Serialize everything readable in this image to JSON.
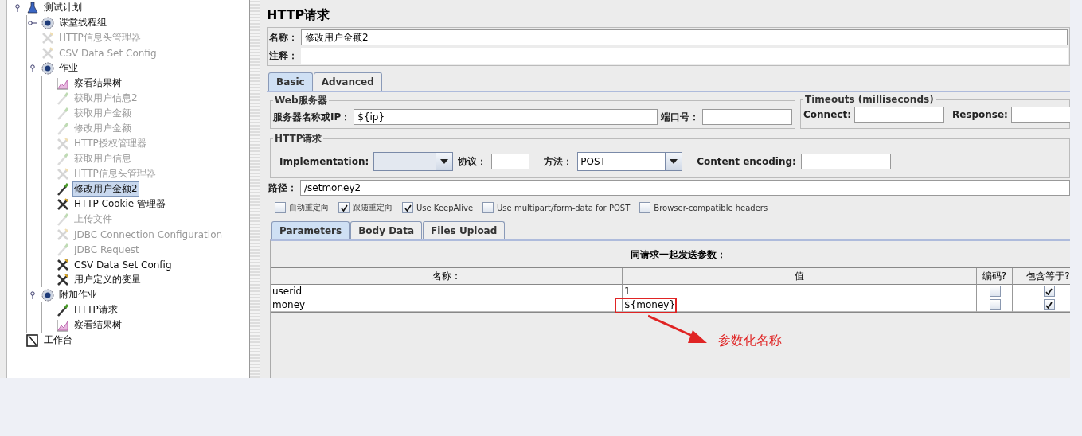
{
  "tree": [
    {
      "label": "测试计划",
      "kind": "plan",
      "disabled": false,
      "selected": false,
      "expanded": true,
      "children": [
        {
          "label": "课堂线程组",
          "kind": "threadgroup",
          "disabled": false,
          "selected": false,
          "expanded": false
        },
        {
          "label": "HTTP信息头管理器",
          "kind": "config",
          "disabled": true,
          "selected": false
        },
        {
          "label": "CSV Data Set Config",
          "kind": "config",
          "disabled": true,
          "selected": false
        },
        {
          "label": "作业",
          "kind": "threadgroup",
          "disabled": false,
          "selected": false,
          "expanded": true,
          "children": [
            {
              "label": "察看结果树",
              "kind": "listener",
              "disabled": false,
              "selected": false
            },
            {
              "label": "获取用户信息2",
              "kind": "sampler",
              "disabled": true,
              "selected": false
            },
            {
              "label": "获取用户金额",
              "kind": "sampler",
              "disabled": true,
              "selected": false
            },
            {
              "label": "修改用户金额",
              "kind": "sampler",
              "disabled": true,
              "selected": false
            },
            {
              "label": "HTTP授权管理器",
              "kind": "config",
              "disabled": true,
              "selected": false
            },
            {
              "label": "获取用户信息",
              "kind": "sampler",
              "disabled": true,
              "selected": false
            },
            {
              "label": "HTTP信息头管理器",
              "kind": "config",
              "disabled": true,
              "selected": false
            },
            {
              "label": "修改用户金额2",
              "kind": "sampler",
              "disabled": false,
              "selected": true
            },
            {
              "label": "HTTP Cookie 管理器",
              "kind": "config",
              "disabled": false,
              "selected": false
            },
            {
              "label": "上传文件",
              "kind": "sampler",
              "disabled": true,
              "selected": false
            },
            {
              "label": "JDBC Connection Configuration",
              "kind": "config",
              "disabled": true,
              "selected": false
            },
            {
              "label": "JDBC Request",
              "kind": "sampler",
              "disabled": true,
              "selected": false
            },
            {
              "label": "CSV Data Set Config",
              "kind": "config",
              "disabled": false,
              "selected": false
            },
            {
              "label": "用户定义的变量",
              "kind": "config",
              "disabled": false,
              "selected": false
            }
          ]
        },
        {
          "label": "附加作业",
          "kind": "threadgroup",
          "disabled": false,
          "selected": false,
          "expanded": true,
          "children": [
            {
              "label": "HTTP请求",
              "kind": "sampler",
              "disabled": false,
              "selected": false
            },
            {
              "label": "察看结果树",
              "kind": "listener",
              "disabled": false,
              "selected": false
            }
          ]
        }
      ]
    },
    {
      "label": "工作台",
      "kind": "workbench",
      "disabled": false,
      "selected": false
    }
  ],
  "editor": {
    "title": "HTTP请求",
    "name_label": "名称：",
    "name_value": "修改用户金额2",
    "comment_label": "注释：",
    "tabs": [
      {
        "label": "Basic",
        "selected": true
      },
      {
        "label": "Advanced",
        "selected": false
      }
    ],
    "web_server": {
      "legend": "Web服务器",
      "server_label": "服务器名称或IP：",
      "server_value": "${ip}",
      "port_label": "端口号："
    },
    "timeouts": {
      "legend": "Timeouts (milliseconds)",
      "connect_label": "Connect:",
      "response_label": "Response:"
    },
    "http_request": {
      "legend": "HTTP请求",
      "implementation_label": "Implementation:",
      "protocol_label": "协议：",
      "method_label": "方法：",
      "method_value": "POST",
      "encoding_label": "Content encoding:",
      "path_label": "路径：",
      "path_value": "/setmoney2",
      "options": [
        {
          "label": "自动重定向",
          "checked": false
        },
        {
          "label": "跟随重定向",
          "checked": true
        },
        {
          "label": "Use KeepAlive",
          "checked": true
        },
        {
          "label": "Use multipart/form-data for POST",
          "checked": false
        },
        {
          "label": "Browser-compatible headers",
          "checked": false
        }
      ]
    },
    "sub_tabs": [
      {
        "label": "Parameters",
        "selected": true
      },
      {
        "label": "Body Data",
        "selected": false
      },
      {
        "label": "Files Upload",
        "selected": false
      }
    ],
    "parameters": {
      "caption": "同请求一起发送参数：",
      "columns": [
        "名称：",
        "值",
        "编码?",
        "包含等于?"
      ],
      "rows": [
        {
          "name": "userid",
          "value": "1",
          "encode": false,
          "include_equals": true,
          "highlighted": false
        },
        {
          "name": "money",
          "value": "${money}",
          "encode": false,
          "include_equals": true,
          "highlighted": true
        }
      ]
    },
    "annotation": {
      "text": "参数化名称"
    }
  }
}
